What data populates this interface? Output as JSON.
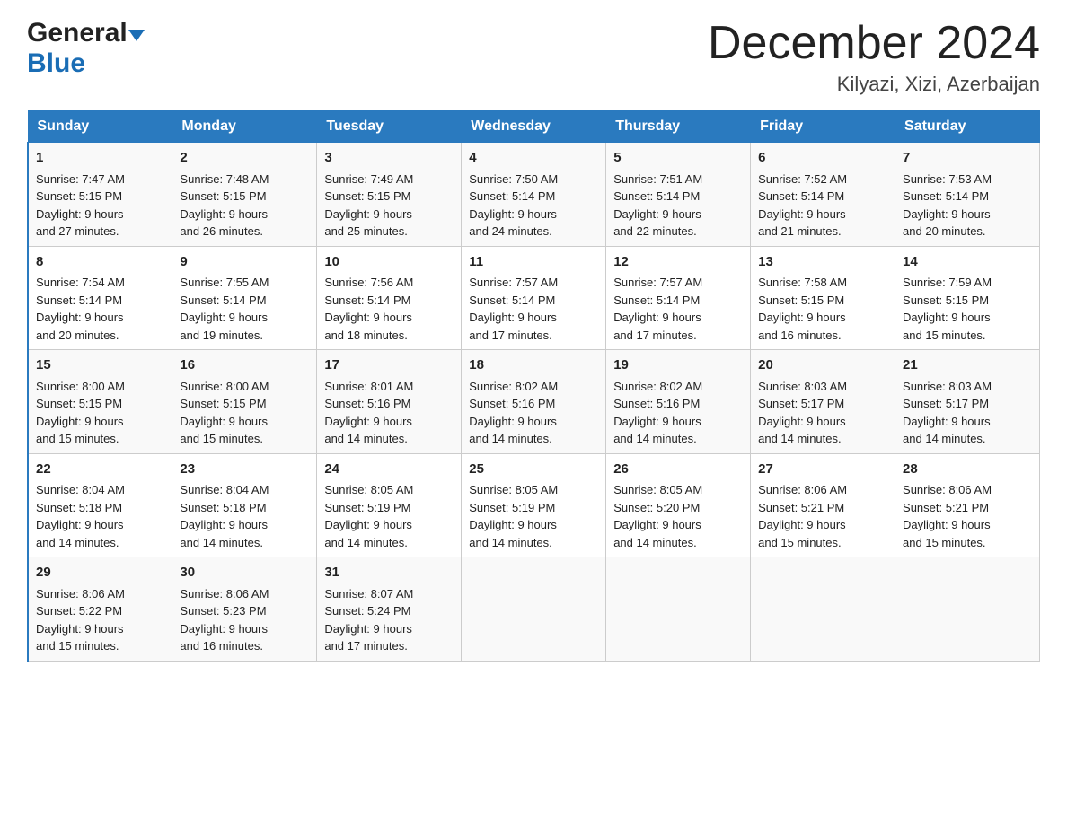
{
  "header": {
    "logo_general": "General",
    "logo_blue": "Blue",
    "month_title": "December 2024",
    "location": "Kilyazi, Xizi, Azerbaijan"
  },
  "days_of_week": [
    "Sunday",
    "Monday",
    "Tuesday",
    "Wednesday",
    "Thursday",
    "Friday",
    "Saturday"
  ],
  "weeks": [
    [
      {
        "day": "1",
        "sunrise": "7:47 AM",
        "sunset": "5:15 PM",
        "daylight": "9 hours and 27 minutes."
      },
      {
        "day": "2",
        "sunrise": "7:48 AM",
        "sunset": "5:15 PM",
        "daylight": "9 hours and 26 minutes."
      },
      {
        "day": "3",
        "sunrise": "7:49 AM",
        "sunset": "5:15 PM",
        "daylight": "9 hours and 25 minutes."
      },
      {
        "day": "4",
        "sunrise": "7:50 AM",
        "sunset": "5:14 PM",
        "daylight": "9 hours and 24 minutes."
      },
      {
        "day": "5",
        "sunrise": "7:51 AM",
        "sunset": "5:14 PM",
        "daylight": "9 hours and 22 minutes."
      },
      {
        "day": "6",
        "sunrise": "7:52 AM",
        "sunset": "5:14 PM",
        "daylight": "9 hours and 21 minutes."
      },
      {
        "day": "7",
        "sunrise": "7:53 AM",
        "sunset": "5:14 PM",
        "daylight": "9 hours and 20 minutes."
      }
    ],
    [
      {
        "day": "8",
        "sunrise": "7:54 AM",
        "sunset": "5:14 PM",
        "daylight": "9 hours and 20 minutes."
      },
      {
        "day": "9",
        "sunrise": "7:55 AM",
        "sunset": "5:14 PM",
        "daylight": "9 hours and 19 minutes."
      },
      {
        "day": "10",
        "sunrise": "7:56 AM",
        "sunset": "5:14 PM",
        "daylight": "9 hours and 18 minutes."
      },
      {
        "day": "11",
        "sunrise": "7:57 AM",
        "sunset": "5:14 PM",
        "daylight": "9 hours and 17 minutes."
      },
      {
        "day": "12",
        "sunrise": "7:57 AM",
        "sunset": "5:14 PM",
        "daylight": "9 hours and 17 minutes."
      },
      {
        "day": "13",
        "sunrise": "7:58 AM",
        "sunset": "5:15 PM",
        "daylight": "9 hours and 16 minutes."
      },
      {
        "day": "14",
        "sunrise": "7:59 AM",
        "sunset": "5:15 PM",
        "daylight": "9 hours and 15 minutes."
      }
    ],
    [
      {
        "day": "15",
        "sunrise": "8:00 AM",
        "sunset": "5:15 PM",
        "daylight": "9 hours and 15 minutes."
      },
      {
        "day": "16",
        "sunrise": "8:00 AM",
        "sunset": "5:15 PM",
        "daylight": "9 hours and 15 minutes."
      },
      {
        "day": "17",
        "sunrise": "8:01 AM",
        "sunset": "5:16 PM",
        "daylight": "9 hours and 14 minutes."
      },
      {
        "day": "18",
        "sunrise": "8:02 AM",
        "sunset": "5:16 PM",
        "daylight": "9 hours and 14 minutes."
      },
      {
        "day": "19",
        "sunrise": "8:02 AM",
        "sunset": "5:16 PM",
        "daylight": "9 hours and 14 minutes."
      },
      {
        "day": "20",
        "sunrise": "8:03 AM",
        "sunset": "5:17 PM",
        "daylight": "9 hours and 14 minutes."
      },
      {
        "day": "21",
        "sunrise": "8:03 AM",
        "sunset": "5:17 PM",
        "daylight": "9 hours and 14 minutes."
      }
    ],
    [
      {
        "day": "22",
        "sunrise": "8:04 AM",
        "sunset": "5:18 PM",
        "daylight": "9 hours and 14 minutes."
      },
      {
        "day": "23",
        "sunrise": "8:04 AM",
        "sunset": "5:18 PM",
        "daylight": "9 hours and 14 minutes."
      },
      {
        "day": "24",
        "sunrise": "8:05 AM",
        "sunset": "5:19 PM",
        "daylight": "9 hours and 14 minutes."
      },
      {
        "day": "25",
        "sunrise": "8:05 AM",
        "sunset": "5:19 PM",
        "daylight": "9 hours and 14 minutes."
      },
      {
        "day": "26",
        "sunrise": "8:05 AM",
        "sunset": "5:20 PM",
        "daylight": "9 hours and 14 minutes."
      },
      {
        "day": "27",
        "sunrise": "8:06 AM",
        "sunset": "5:21 PM",
        "daylight": "9 hours and 15 minutes."
      },
      {
        "day": "28",
        "sunrise": "8:06 AM",
        "sunset": "5:21 PM",
        "daylight": "9 hours and 15 minutes."
      }
    ],
    [
      {
        "day": "29",
        "sunrise": "8:06 AM",
        "sunset": "5:22 PM",
        "daylight": "9 hours and 15 minutes."
      },
      {
        "day": "30",
        "sunrise": "8:06 AM",
        "sunset": "5:23 PM",
        "daylight": "9 hours and 16 minutes."
      },
      {
        "day": "31",
        "sunrise": "8:07 AM",
        "sunset": "5:24 PM",
        "daylight": "9 hours and 17 minutes."
      },
      {
        "day": "",
        "sunrise": "",
        "sunset": "",
        "daylight": ""
      },
      {
        "day": "",
        "sunrise": "",
        "sunset": "",
        "daylight": ""
      },
      {
        "day": "",
        "sunrise": "",
        "sunset": "",
        "daylight": ""
      },
      {
        "day": "",
        "sunrise": "",
        "sunset": "",
        "daylight": ""
      }
    ]
  ],
  "labels": {
    "sunrise_prefix": "Sunrise: ",
    "sunset_prefix": "Sunset: ",
    "daylight_prefix": "Daylight: "
  }
}
